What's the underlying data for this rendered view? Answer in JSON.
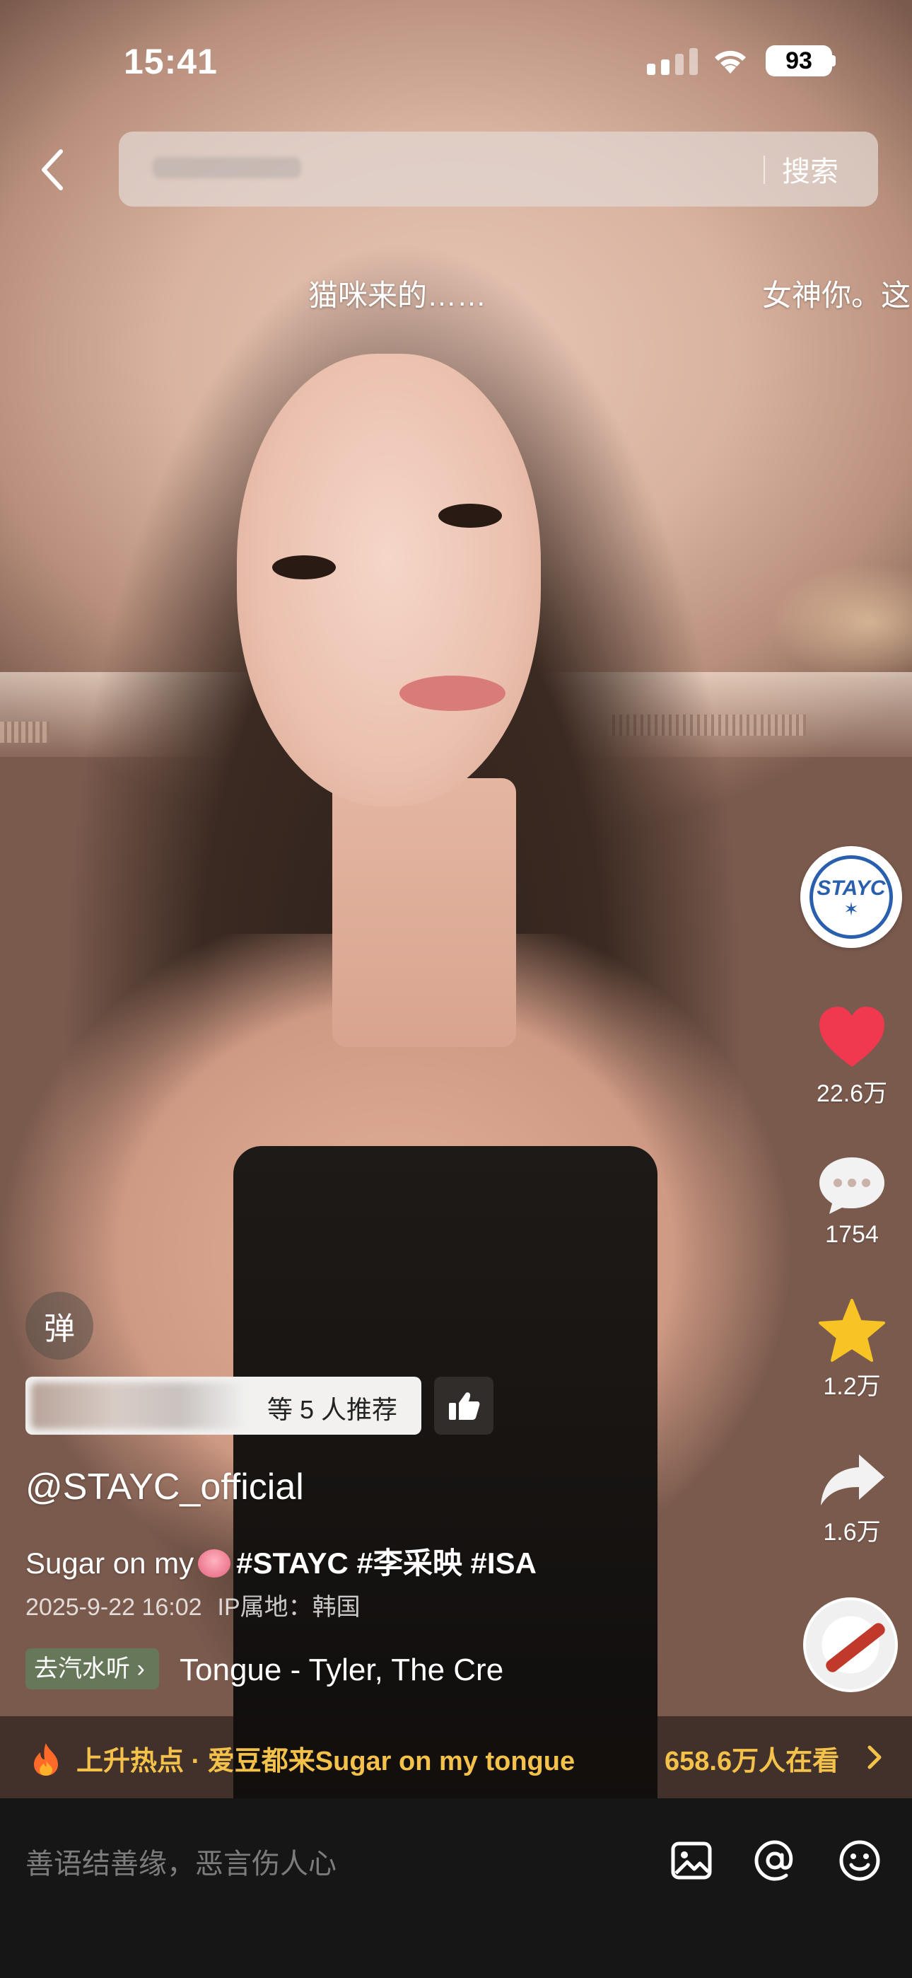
{
  "status_bar": {
    "time": "15:41",
    "battery": "93"
  },
  "search": {
    "button_label": "搜索"
  },
  "danmaku": [
    "猫咪来的……",
    "女神你。这"
  ],
  "actions": {
    "avatar_text": "STAYC",
    "likes": "22.6万",
    "comments": "1754",
    "favorites": "1.2万",
    "shares": "1.6万"
  },
  "video_info": {
    "danmaku_toggle": "弹",
    "recommend_text": "等 5 人推荐",
    "username": "@STAYC_official",
    "caption_text": "Sugar on my",
    "caption_tags": "#STAYC #李采映 #ISA",
    "date": "2025-9-22 16:02",
    "ip_location": "IP属地：韩国",
    "music_tag": "去汽水听",
    "song": "Tongue - Tyler, The Cre"
  },
  "hot": {
    "text": "上升热点 · 爱豆都来Sugar on my tongue",
    "viewers": "658.6万人在看"
  },
  "comment_bar": {
    "placeholder": "善语结善缘，恶言伤人心"
  },
  "colors": {
    "like_red": "#f0384f",
    "favorite_yellow": "#f8c325",
    "hot_gold": "#f4c24a",
    "comment_bar_bg": "#161616"
  }
}
